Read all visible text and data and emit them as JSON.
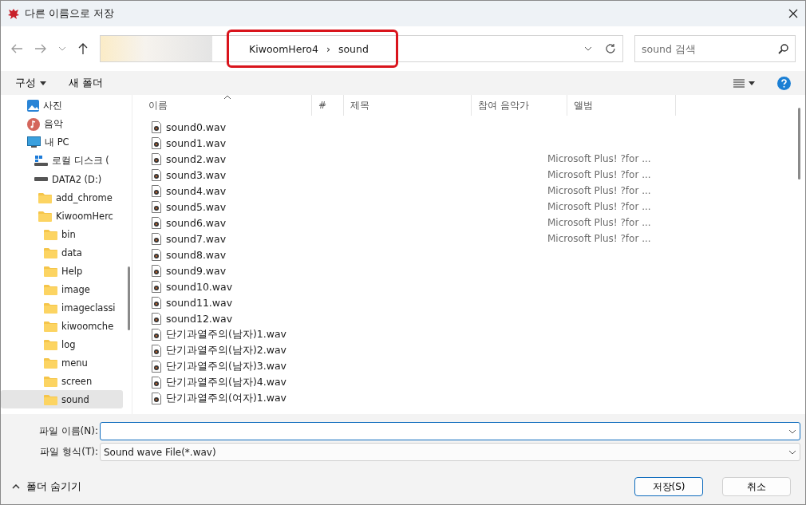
{
  "window": {
    "title": "다른 이름으로 저장"
  },
  "address": {
    "crumbs": [
      "KiwoomHero4",
      "sound"
    ],
    "separator": "›"
  },
  "search": {
    "placeholder": "sound 검색"
  },
  "toolbar": {
    "organize": "구성",
    "new_folder": "새 폴더"
  },
  "sidebar": {
    "items": [
      {
        "label": "사진",
        "kind": "pictures",
        "selected": false
      },
      {
        "label": "음악",
        "kind": "music",
        "selected": false
      },
      {
        "label": "내 PC",
        "kind": "pc",
        "selected": false,
        "children": [
          {
            "label": "로컬 디스크 (",
            "kind": "windrive",
            "selected": false
          },
          {
            "label": "DATA2 (D:)",
            "kind": "drive",
            "selected": false,
            "children": [
              {
                "label": "add_chrome",
                "kind": "folder",
                "selected": false
              },
              {
                "label": "KiwoomHerc",
                "kind": "folder",
                "selected": false,
                "children": [
                  {
                    "label": "bin",
                    "kind": "folder",
                    "selected": false
                  },
                  {
                    "label": "data",
                    "kind": "folder",
                    "selected": false
                  },
                  {
                    "label": "Help",
                    "kind": "folder",
                    "selected": false
                  },
                  {
                    "label": "image",
                    "kind": "folder",
                    "selected": false
                  },
                  {
                    "label": "imageclassi",
                    "kind": "folder",
                    "selected": false
                  },
                  {
                    "label": "kiwoomche",
                    "kind": "folder",
                    "selected": false
                  },
                  {
                    "label": "log",
                    "kind": "folder",
                    "selected": false
                  },
                  {
                    "label": "menu",
                    "kind": "folder",
                    "selected": false
                  },
                  {
                    "label": "screen",
                    "kind": "folder",
                    "selected": false
                  },
                  {
                    "label": "sound",
                    "kind": "folder",
                    "selected": true
                  }
                ]
              }
            ]
          }
        ]
      }
    ]
  },
  "table": {
    "columns": [
      "이름",
      "#",
      "제목",
      "참여 음악가",
      "앨범"
    ],
    "rows": [
      {
        "name": "sound0.wav"
      },
      {
        "name": "sound1.wav"
      },
      {
        "name": "sound2.wav",
        "album": "Microsoft Plus! ?for ..."
      },
      {
        "name": "sound3.wav",
        "album": "Microsoft Plus! ?for ..."
      },
      {
        "name": "sound4.wav",
        "album": "Microsoft Plus! ?for ..."
      },
      {
        "name": "sound5.wav",
        "album": "Microsoft Plus! ?for ..."
      },
      {
        "name": "sound6.wav",
        "album": "Microsoft Plus! ?for ..."
      },
      {
        "name": "sound7.wav",
        "album": "Microsoft Plus! ?for ..."
      },
      {
        "name": "sound8.wav"
      },
      {
        "name": "sound9.wav"
      },
      {
        "name": "sound10.wav"
      },
      {
        "name": "sound11.wav"
      },
      {
        "name": "sound12.wav"
      },
      {
        "name": "단기과열주의(남자)1.wav"
      },
      {
        "name": "단기과열주의(남자)2.wav"
      },
      {
        "name": "단기과열주의(남자)3.wav"
      },
      {
        "name": "단기과열주의(남자)4.wav"
      },
      {
        "name": "단기과열주의(여자)1.wav"
      }
    ]
  },
  "file_name": {
    "label": "파일 이름(N):"
  },
  "file_type": {
    "label": "파일 형식(T):",
    "value": "Sound wave File(*.wav)"
  },
  "footer": {
    "toggle": "폴더 숨기기",
    "save": "저장(S)",
    "cancel": "취소"
  }
}
